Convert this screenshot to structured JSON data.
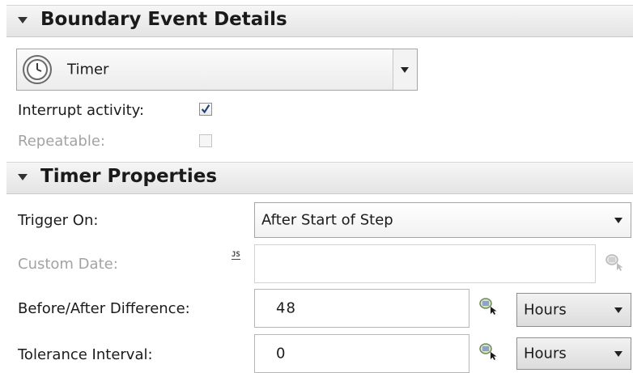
{
  "boundary": {
    "header": "Boundary Event Details",
    "event_type": "Timer",
    "interrupt_label": "Interrupt activity:",
    "interrupt_checked": true,
    "repeatable_label": "Repeatable:",
    "repeatable_checked": false
  },
  "timer": {
    "header": "Timer Properties",
    "trigger_on_label": "Trigger On:",
    "trigger_on_value": "After Start of Step",
    "custom_date_label": "Custom Date:",
    "custom_date_value": "",
    "before_after_label": "Before/After Difference:",
    "before_after_value": "48",
    "before_after_unit": "Hours",
    "tolerance_label": "Tolerance Interval:",
    "tolerance_value": "0",
    "tolerance_unit": "Hours"
  },
  "icons": {
    "section_toggle": "triangle-down-icon",
    "timer": "clock-icon",
    "js": "javascript-icon",
    "variable_picker": "variable-picker-icon"
  },
  "colors": {
    "header_bg": "#e8e8e8",
    "disabled_text": "#a3a3a3",
    "check_mark": "#1d3f7a"
  }
}
